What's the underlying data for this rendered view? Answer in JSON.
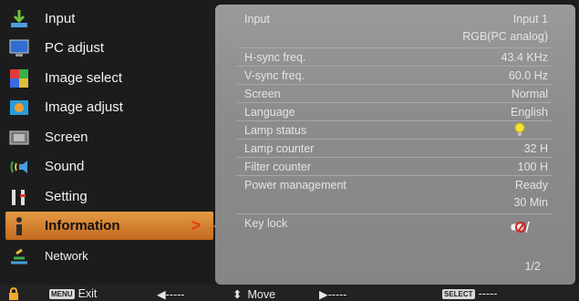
{
  "left_menu": {
    "items": [
      {
        "label": "Input",
        "icon": "input-icon"
      },
      {
        "label": "PC adjust",
        "icon": "pc-adjust-icon"
      },
      {
        "label": "Image select",
        "icon": "image-select-icon"
      },
      {
        "label": "Image adjust",
        "icon": "image-adjust-icon"
      },
      {
        "label": "Screen",
        "icon": "screen-icon"
      },
      {
        "label": "Sound",
        "icon": "sound-icon"
      },
      {
        "label": "Setting",
        "icon": "setting-icon"
      },
      {
        "label": "Information",
        "icon": "information-icon",
        "active": true,
        "arrow": ">"
      },
      {
        "label": "Network",
        "icon": "network-icon"
      }
    ]
  },
  "info": {
    "rows": [
      {
        "label": "Input",
        "value": "Input 1",
        "value2": "RGB(PC analog)"
      },
      {
        "label": "H-sync freq.",
        "value": "43.4 KHz"
      },
      {
        "label": "V-sync freq.",
        "value": "60.0 Hz"
      },
      {
        "label": "Screen",
        "value": "Normal"
      },
      {
        "label": "Language",
        "value": "English"
      },
      {
        "label": "Lamp status",
        "value": ""
      },
      {
        "label": "Lamp counter",
        "value": "32 H"
      },
      {
        "label": "Filter counter",
        "value": "100 H"
      },
      {
        "label": "Power management",
        "value": "Ready",
        "value2": "30 Min"
      },
      {
        "label": "Key lock",
        "value": ""
      }
    ],
    "page": "1/2"
  },
  "bottom_bar": {
    "menu_key": "MENU",
    "exit_label": "Exit",
    "left_dashes": "◀-----",
    "move_label": "Move",
    "right_dashes": "▶-----",
    "select_key": "SELECT",
    "select_dashes": "-----"
  },
  "colors": {
    "panel_bg": "#8c8c8c",
    "active_item": "#d9843a",
    "arrow": "#e83a1a"
  }
}
